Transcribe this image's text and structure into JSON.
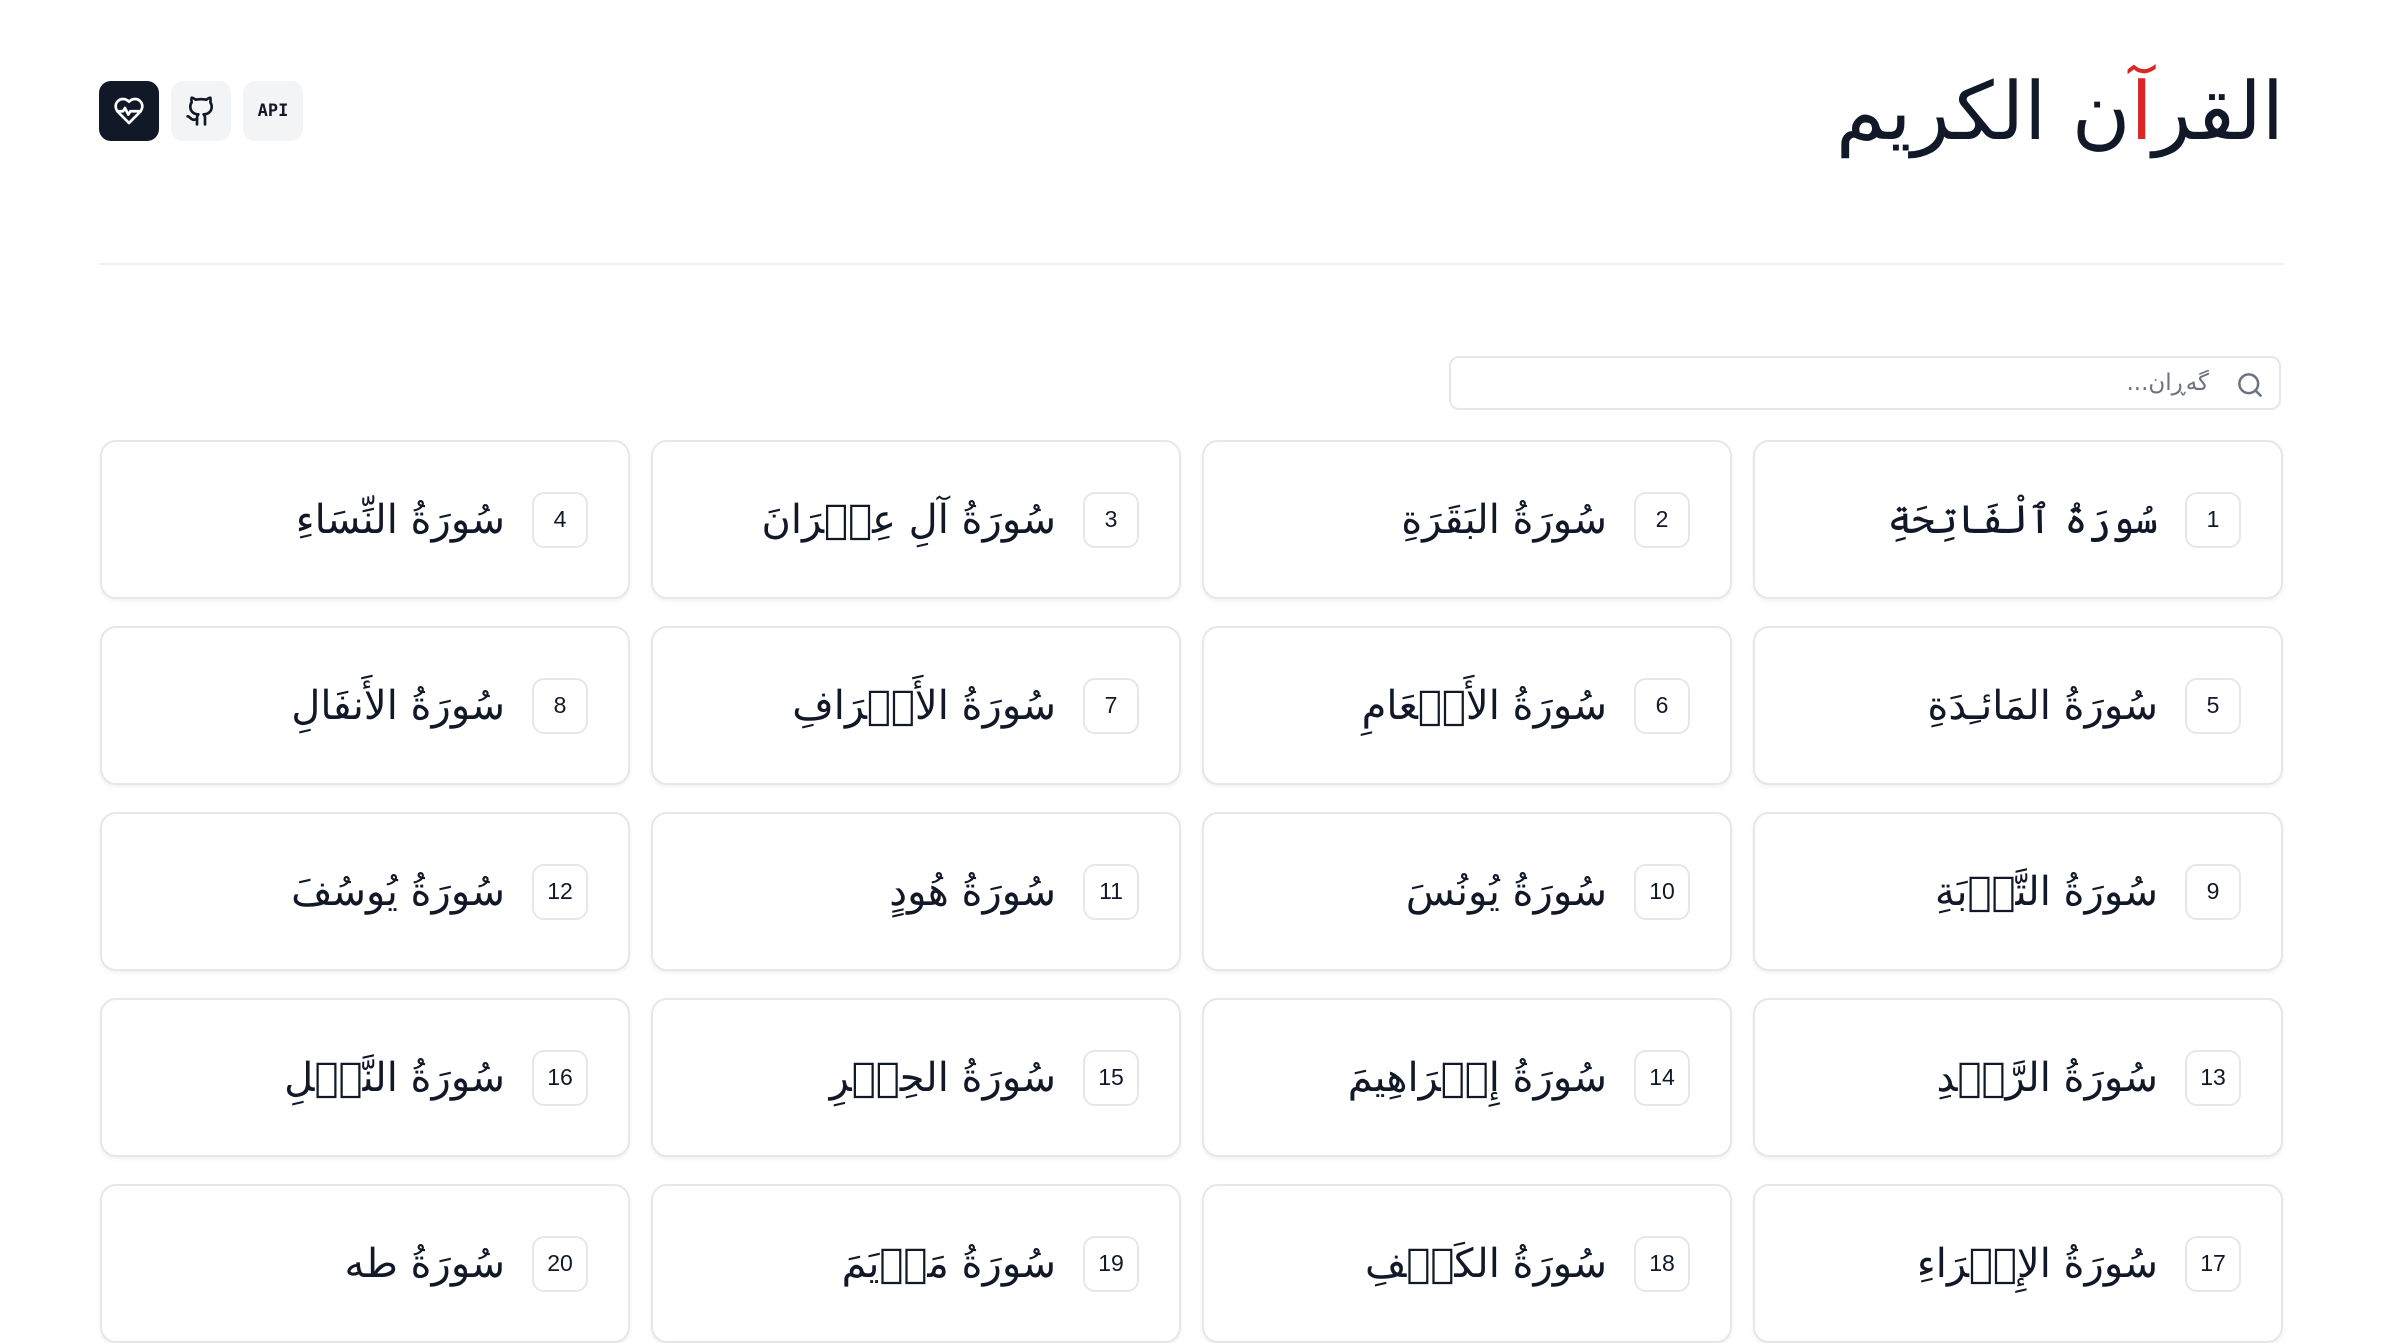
{
  "header": {
    "title": "القرآن الكريم",
    "title_accent_color": "#dc2626",
    "buttons": [
      {
        "name": "heart-pulse-icon",
        "style": "dark"
      },
      {
        "name": "github-icon",
        "style": "light"
      },
      {
        "name": "api-button",
        "label": "API",
        "style": "light"
      }
    ]
  },
  "search": {
    "placeholder": "گەڕان...",
    "value": ""
  },
  "surahs": [
    {
      "number": "1",
      "name": "سُورَةُ ٱلْفَاتِحَةِ"
    },
    {
      "number": "2",
      "name": "سُورَةُ البَقَرَةِ"
    },
    {
      "number": "3",
      "name": "سُورَةُ آلِ عِمۡرَانَ"
    },
    {
      "number": "4",
      "name": "سُورَةُ النِّسَاءِ"
    },
    {
      "number": "5",
      "name": "سُورَةُ المَائـِدَةِ"
    },
    {
      "number": "6",
      "name": "سُورَةُ الأَنۡعَامِ"
    },
    {
      "number": "7",
      "name": "سُورَةُ الأَعۡرَافِ"
    },
    {
      "number": "8",
      "name": "سُورَةُ الأَنفَالِ"
    },
    {
      "number": "9",
      "name": "سُورَةُ التَّوۡبَةِ"
    },
    {
      "number": "10",
      "name": "سُورَةُ يُونُسَ"
    },
    {
      "number": "11",
      "name": "سُورَةُ هُودٍ"
    },
    {
      "number": "12",
      "name": "سُورَةُ يُوسُفَ"
    },
    {
      "number": "13",
      "name": "سُورَةُ الرَّعۡدِ"
    },
    {
      "number": "14",
      "name": "سُورَةُ إِبۡرَاهِيمَ"
    },
    {
      "number": "15",
      "name": "سُورَةُ الحِجۡرِ"
    },
    {
      "number": "16",
      "name": "سُورَةُ النَّحۡلِ"
    },
    {
      "number": "17",
      "name": "سُورَةُ الإِسۡرَاءِ"
    },
    {
      "number": "18",
      "name": "سُورَةُ الكَهۡفِ"
    },
    {
      "number": "19",
      "name": "سُورَةُ مَرۡيَمَ"
    },
    {
      "number": "20",
      "name": "سُورَةُ طه"
    }
  ]
}
